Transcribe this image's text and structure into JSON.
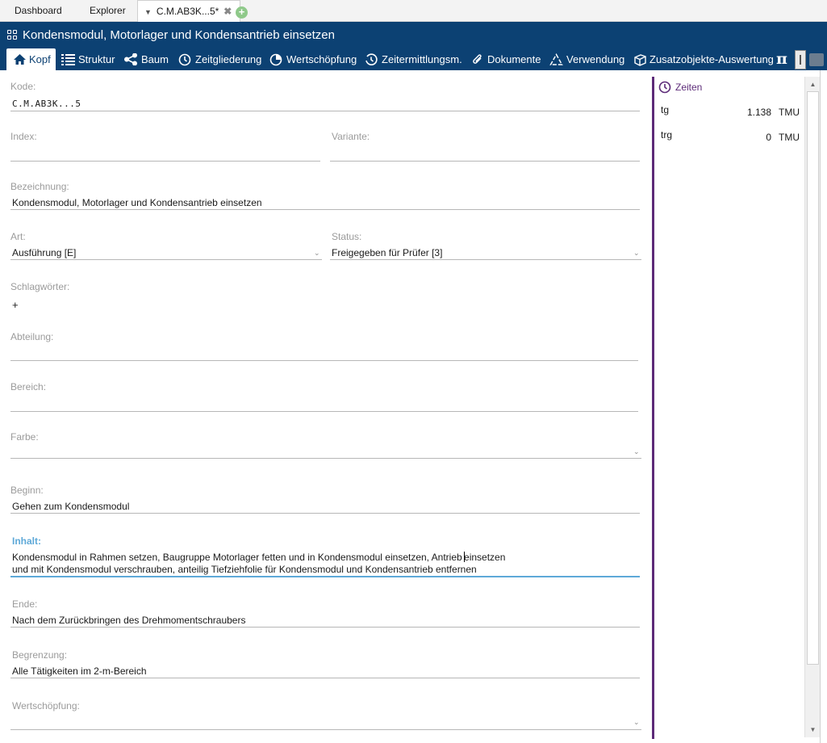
{
  "tabs": {
    "dashboard": "Dashboard",
    "explorer": "Explorer",
    "active": "C.M.AB3K...5*",
    "close": "✖",
    "add": "+"
  },
  "window": {
    "title": "Kondensmodul, Motorlager und Kondensantrieb einsetzen"
  },
  "toolbar": {
    "kopf": "Kopf",
    "struktur": "Struktur",
    "baum": "Baum",
    "zeitgliederung": "Zeitgliederung",
    "wertschoepfung": "Wertschöpfung",
    "zeitermittlung": "Zeitermittlungsm.",
    "dokumente": "Dokumente",
    "verwendung": "Verwendung",
    "zusatzobjekte": "Zusatzobjekte-Auswertung",
    "pi": "π"
  },
  "form": {
    "kode_label": "Kode:",
    "kode_value": "C.M.AB3K...5",
    "index_label": "Index:",
    "index_value": "",
    "variante_label": "Variante:",
    "variante_value": "",
    "bezeichnung_label": "Bezeichnung:",
    "bezeichnung_value": "Kondensmodul, Motorlager und Kondensantrieb einsetzen",
    "art_label": "Art:",
    "art_value": "Ausführung [E]",
    "status_label": "Status:",
    "status_value": "Freigegeben für Prüfer [3]",
    "schlagwoerter_label": "Schlagwörter:",
    "schlagwoerter_add": "+",
    "abteilung_label": "Abteilung:",
    "abteilung_value": "",
    "bereich_label": "Bereich:",
    "bereich_value": "",
    "farbe_label": "Farbe:",
    "farbe_value": "",
    "beginn_label": "Beginn:",
    "beginn_value": "Gehen zum Kondensmodul",
    "inhalt_label": "Inhalt:",
    "inhalt_line1_a": "Kondensmodul in Rahmen setzen, Baugruppe Motorlager fetten und in Kondensmodul einsetzen, Antrieb ",
    "inhalt_line1_b": "einsetzen",
    "inhalt_line2": "und mit Kondensmodul verschrauben, anteilig Tiefziehfolie für Kondensmodul und Kondensantrieb entfernen",
    "ende_label": "Ende:",
    "ende_value": "Nach dem Zurückbringen des Drehmomentschraubers",
    "begrenzung_label": "Begrenzung:",
    "begrenzung_value": "Alle Tätigkeiten im 2-m-Bereich",
    "wertschoepfung_label": "Wertschöpfung:",
    "wertschoepfung_value": ""
  },
  "zeiten": {
    "title": "Zeiten",
    "rows": [
      {
        "key": "tg",
        "value": "1.138",
        "unit": "TMU"
      },
      {
        "key": "trg",
        "value": "0",
        "unit": "TMU"
      }
    ]
  },
  "colors": {
    "primary": "#0c4173",
    "accent_purple": "#5c2a78",
    "focus_blue": "#5ea9d8"
  }
}
